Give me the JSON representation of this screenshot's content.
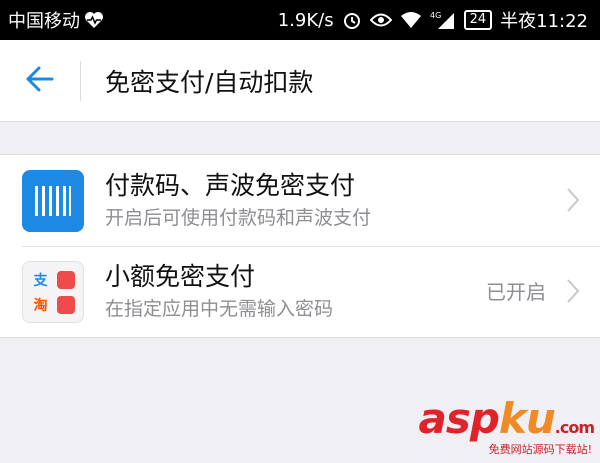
{
  "status_bar": {
    "carrier": "中国移动",
    "speed": "1.9K/s",
    "network": "4G",
    "battery": "24",
    "time": "半夜11:22"
  },
  "nav": {
    "title": "免密支付/自动扣款"
  },
  "list": {
    "items": [
      {
        "title": "付款码、声波免密支付",
        "subtitle": "开启后可使用付款码和声波支付",
        "status": ""
      },
      {
        "title": "小额免密支付",
        "subtitle": "在指定应用中无需输入密码",
        "status": "已开启"
      }
    ]
  },
  "app_icons": {
    "alipay": "支",
    "taobao": "淘"
  },
  "watermark": {
    "logo_asp": "asp",
    "logo_ku": "ku",
    "logo_com": ".com",
    "tagline": "免费网站源码下载站!"
  },
  "colors": {
    "accent": "#1e88e5",
    "status_bar_bg": "#000000",
    "page_bg": "#f0f0f4"
  }
}
